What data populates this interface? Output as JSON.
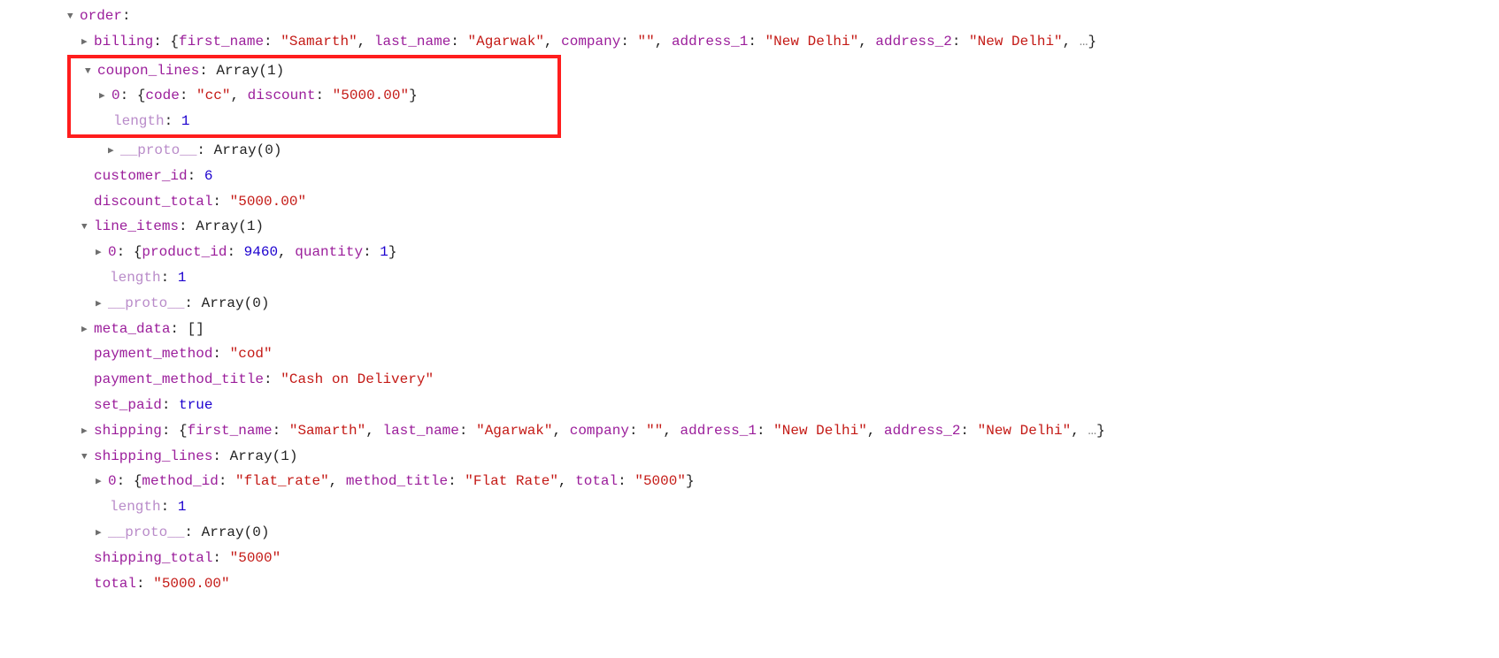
{
  "order_label": "order",
  "billing": {
    "label": "billing",
    "first_name_k": "first_name",
    "first_name_v": "\"Samarth\"",
    "last_name_k": "last_name",
    "last_name_v": "\"Agarwak\"",
    "company_k": "company",
    "company_v": "\"\"",
    "address_1_k": "address_1",
    "address_1_v": "\"New Delhi\"",
    "address_2_k": "address_2",
    "address_2_v": "\"New Delhi\""
  },
  "coupon_lines": {
    "label": "coupon_lines",
    "array_text": "Array(1)",
    "idx0": "0",
    "code_k": "code",
    "code_v": "\"cc\"",
    "discount_k": "discount",
    "discount_v": "\"5000.00\"",
    "length_k": "length",
    "length_v": "1"
  },
  "proto": {
    "label": "__proto__",
    "value": "Array(0)"
  },
  "customer_id": {
    "label": "customer_id",
    "value": "6"
  },
  "discount_total": {
    "label": "discount_total",
    "value": "\"5000.00\""
  },
  "line_items": {
    "label": "line_items",
    "array_text": "Array(1)",
    "idx0": "0",
    "product_id_k": "product_id",
    "product_id_v": "9460",
    "quantity_k": "quantity",
    "quantity_v": "1",
    "length_k": "length",
    "length_v": "1"
  },
  "meta_data": {
    "label": "meta_data",
    "value": "[]"
  },
  "payment_method": {
    "label": "payment_method",
    "value": "\"cod\""
  },
  "payment_method_title": {
    "label": "payment_method_title",
    "value": "\"Cash on Delivery\""
  },
  "set_paid": {
    "label": "set_paid",
    "value": "true"
  },
  "shipping": {
    "label": "shipping",
    "first_name_k": "first_name",
    "first_name_v": "\"Samarth\"",
    "last_name_k": "last_name",
    "last_name_v": "\"Agarwak\"",
    "company_k": "company",
    "company_v": "\"\"",
    "address_1_k": "address_1",
    "address_1_v": "\"New Delhi\"",
    "address_2_k": "address_2",
    "address_2_v": "\"New Delhi\""
  },
  "shipping_lines": {
    "label": "shipping_lines",
    "array_text": "Array(1)",
    "idx0": "0",
    "method_id_k": "method_id",
    "method_id_v": "\"flat_rate\"",
    "method_title_k": "method_title",
    "method_title_v": "\"Flat Rate\"",
    "total_k": "total",
    "total_v": "\"5000\"",
    "length_k": "length",
    "length_v": "1"
  },
  "shipping_total": {
    "label": "shipping_total",
    "value": "\"5000\""
  },
  "total": {
    "label": "total",
    "value": "\"5000.00\""
  },
  "ellipsis": "…",
  "brace_open": "{",
  "brace_close": "}"
}
